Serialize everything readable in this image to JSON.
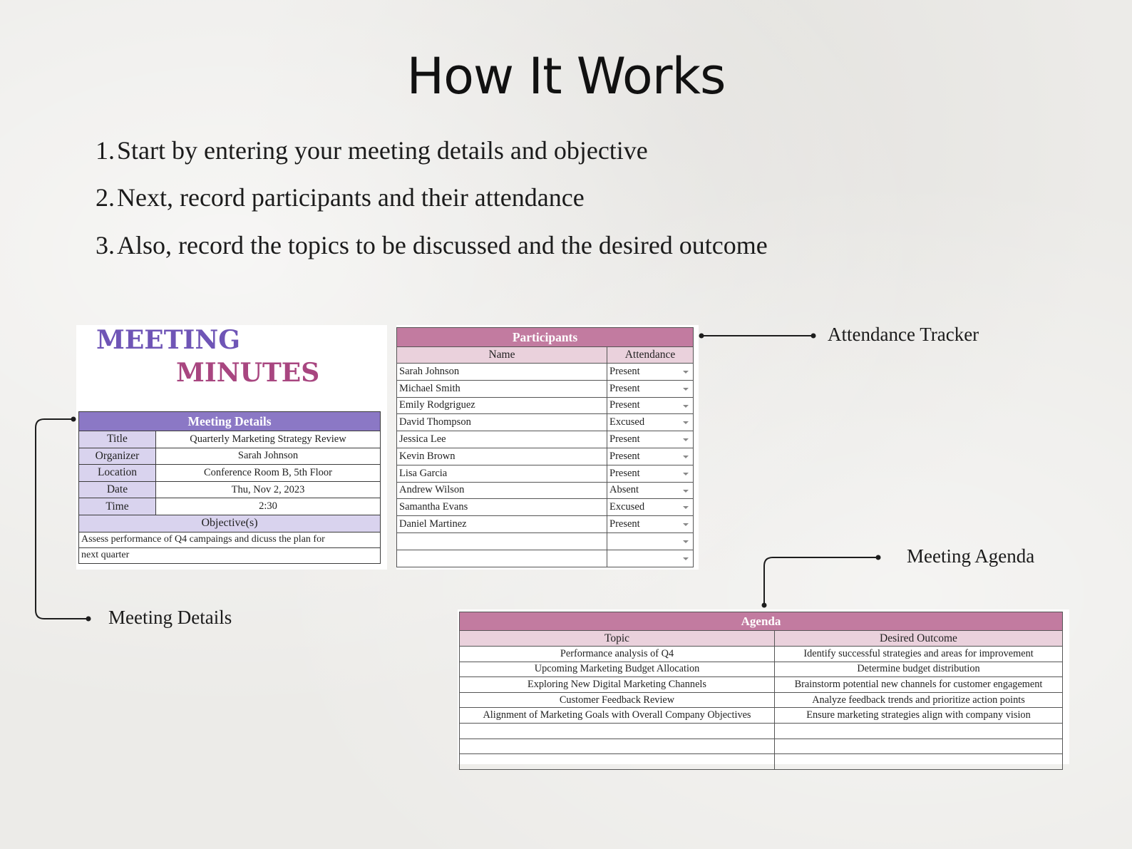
{
  "title": "How It Works",
  "steps": [
    {
      "num": "1.",
      "text": "Start by entering your meeting details and objective"
    },
    {
      "num": "2.",
      "text": "Next, record participants and their attendance"
    },
    {
      "num": "3.",
      "text": "Also, record the topics to be discussed and the desired outcome"
    }
  ],
  "brand": {
    "line1": "MEETING",
    "line2": "MINUTES"
  },
  "meeting_details": {
    "header": "Meeting Details",
    "fields": [
      {
        "label": "Title",
        "value": "Quarterly Marketing Strategy Review"
      },
      {
        "label": "Organizer",
        "value": "Sarah Johnson"
      },
      {
        "label": "Location",
        "value": "Conference Room B, 5th Floor"
      },
      {
        "label": "Date",
        "value": "Thu, Nov 2, 2023"
      },
      {
        "label": "Time",
        "value": "2:30"
      }
    ],
    "objective_label": "Objective(s)",
    "objective_lines": [
      "Assess performance of Q4 campaings and dicuss the plan for",
      "next quarter"
    ]
  },
  "participants": {
    "header": "Participants",
    "columns": [
      "Name",
      "Attendance"
    ],
    "rows": [
      {
        "name": "Sarah Johnson",
        "attendance": "Present"
      },
      {
        "name": "Michael Smith",
        "attendance": "Present"
      },
      {
        "name": "Emily Rodgriguez",
        "attendance": "Present"
      },
      {
        "name": "David Thompson",
        "attendance": "Excused"
      },
      {
        "name": "Jessica Lee",
        "attendance": "Present"
      },
      {
        "name": "Kevin Brown",
        "attendance": "Present"
      },
      {
        "name": "Lisa Garcia",
        "attendance": "Present"
      },
      {
        "name": "Andrew Wilson",
        "attendance": "Absent"
      },
      {
        "name": "Samantha Evans",
        "attendance": "Excused"
      },
      {
        "name": "Daniel Martinez",
        "attendance": "Present"
      },
      {
        "name": "",
        "attendance": ""
      },
      {
        "name": "",
        "attendance": ""
      }
    ]
  },
  "agenda": {
    "header": "Agenda",
    "columns": [
      "Topic",
      "Desired Outcome"
    ],
    "rows": [
      {
        "topic": "Performance analysis of Q4",
        "outcome": "Identify successful strategies and areas for improvement"
      },
      {
        "topic": "Upcoming Marketing Budget Allocation",
        "outcome": "Determine budget distribution"
      },
      {
        "topic": "Exploring New Digital Marketing Channels",
        "outcome": "Brainstorm potential new channels for customer engagement"
      },
      {
        "topic": "Customer Feedback Review",
        "outcome": "Analyze feedback trends and prioritize action points"
      },
      {
        "topic": "Alignment of Marketing Goals with Overall Company Objectives",
        "outcome": "Ensure marketing strategies align with company vision"
      },
      {
        "topic": "",
        "outcome": ""
      },
      {
        "topic": "",
        "outcome": ""
      },
      {
        "topic": "",
        "outcome": ""
      }
    ]
  },
  "callouts": {
    "attendance": "Attendance Tracker",
    "agenda": "Meeting Agenda",
    "details": "Meeting Details"
  },
  "colors": {
    "details_header": "#8b78c5",
    "details_label_bg": "#d9d3ee",
    "pink_header": "#c27ba0",
    "pink_sub": "#ead1dc",
    "brand_purple": "#6f55b6",
    "brand_magenta": "#a84680"
  }
}
